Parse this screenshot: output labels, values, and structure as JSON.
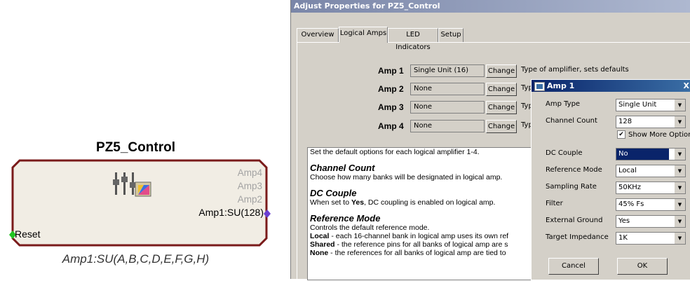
{
  "block": {
    "title": "PZ5_Control",
    "outputs": [
      "Amp4",
      "Amp3",
      "Amp2"
    ],
    "amp1_output": "Amp1:SU(128)",
    "reset": "Reset",
    "caption": "Amp1:SU(A,B,C,D,E,F,G,H)",
    "icon": "sliders-palette-icon",
    "colors": {
      "border": "#7a1a1a",
      "fill": "#f1ede4",
      "input_port": "#22c422",
      "output_port": "#6a3fd1"
    }
  },
  "properties": {
    "title": "Adjust Properties for PZ5_Control",
    "tabs": [
      "Overview",
      "Logical Amps",
      "LED Indicators",
      "Setup"
    ],
    "active_tab": "Logical Amps",
    "amps": [
      {
        "label": "Amp 1",
        "value": "Single Unit (16)",
        "button": "Change",
        "desc": "Type of amplifier, sets defaults"
      },
      {
        "label": "Amp 2",
        "value": "None",
        "button": "Change",
        "desc": "Type"
      },
      {
        "label": "Amp 3",
        "value": "None",
        "button": "Change",
        "desc": "Type"
      },
      {
        "label": "Amp 4",
        "value": "None",
        "button": "Change",
        "desc": "Type"
      }
    ],
    "help": {
      "intro": "Set the default options for each logical amplifier 1-4.",
      "cc_heading": "Channel Count",
      "cc_text": "Choose how many banks will be designated in logical amp.",
      "dc_heading": "DC Couple",
      "dc_pre": "When set to ",
      "dc_bold": "Yes",
      "dc_post": ", DC coupling is enabled on logical amp.",
      "rm_heading": "Reference Mode",
      "rm_text": "Controls the default reference mode.",
      "local_bold": "Local",
      "local_text": " - each 16-channel bank in logical amp uses its own ref",
      "shared_bold": "Shared",
      "shared_text": " - the reference pins for all banks of logical amp are s",
      "none_bold": "None",
      "none_text": " - the references for all banks of logical amp are tied to"
    }
  },
  "dialog": {
    "title": "Amp 1",
    "close": "X",
    "amp_type_label": "Amp Type",
    "amp_type": "Single Unit",
    "channel_count_label": "Channel Count",
    "channel_count": "128",
    "show_more_label": "Show More Options",
    "show_more_checked": true,
    "dc_couple_label": "DC Couple",
    "dc_couple": "No",
    "reference_mode_label": "Reference Mode",
    "reference_mode": "Local",
    "sampling_rate_label": "Sampling Rate",
    "sampling_rate": "50KHz",
    "filter_label": "Filter",
    "filter": "45% Fs",
    "external_ground_label": "External Ground",
    "external_ground": "Yes",
    "target_impedance_label": "Target Impedance",
    "target_impedance": "1K",
    "cancel": "Cancel",
    "ok": "OK"
  }
}
